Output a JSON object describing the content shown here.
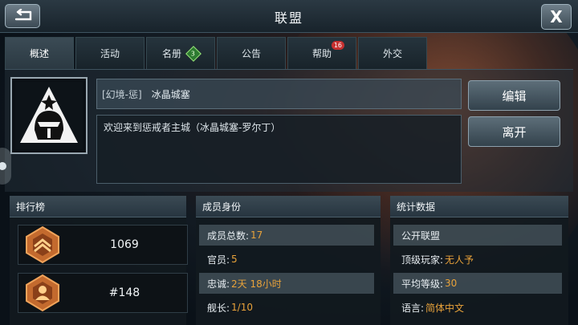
{
  "window": {
    "title": "联盟",
    "close_label": "X"
  },
  "tabs": [
    {
      "label": "概述",
      "active": true
    },
    {
      "label": "活动"
    },
    {
      "label": "名册",
      "badge": "3"
    },
    {
      "label": "公告"
    },
    {
      "label": "帮助",
      "badge": "16"
    },
    {
      "label": "外交"
    }
  ],
  "alliance": {
    "tag": "[幻境-惩]",
    "name": "冰晶城塞",
    "description": "欢迎来到惩戒者主城（冰晶城塞-罗尔丁）",
    "edit_label": "编辑",
    "leave_label": "离开"
  },
  "leaderboard": {
    "title": "排行榜",
    "power": "1069",
    "rank": "#148"
  },
  "membership": {
    "title": "成员身份",
    "rows": [
      {
        "label": "成员总数:",
        "value": "17"
      },
      {
        "label": "官员:",
        "value": "5"
      },
      {
        "label": "忠诚:",
        "value": "2天 18小时"
      },
      {
        "label": "舰长:",
        "value": "1/10"
      }
    ]
  },
  "stats": {
    "title": "统计数据",
    "rows": [
      {
        "label": "公开联盟",
        "value": ""
      },
      {
        "label": "顶级玩家:",
        "value": "无人予"
      },
      {
        "label": "平均等级:",
        "value": "30"
      },
      {
        "label": "语言:",
        "value": "简体中文"
      }
    ]
  },
  "colors": {
    "accent": "#e8a23a",
    "badge_red": "#c63030",
    "badge_green": "#2d7a31"
  },
  "icons": [
    "back-arrow-icon",
    "close-icon",
    "alliance-emblem-icon",
    "rank-medal-icon",
    "rank-members-icon"
  ]
}
